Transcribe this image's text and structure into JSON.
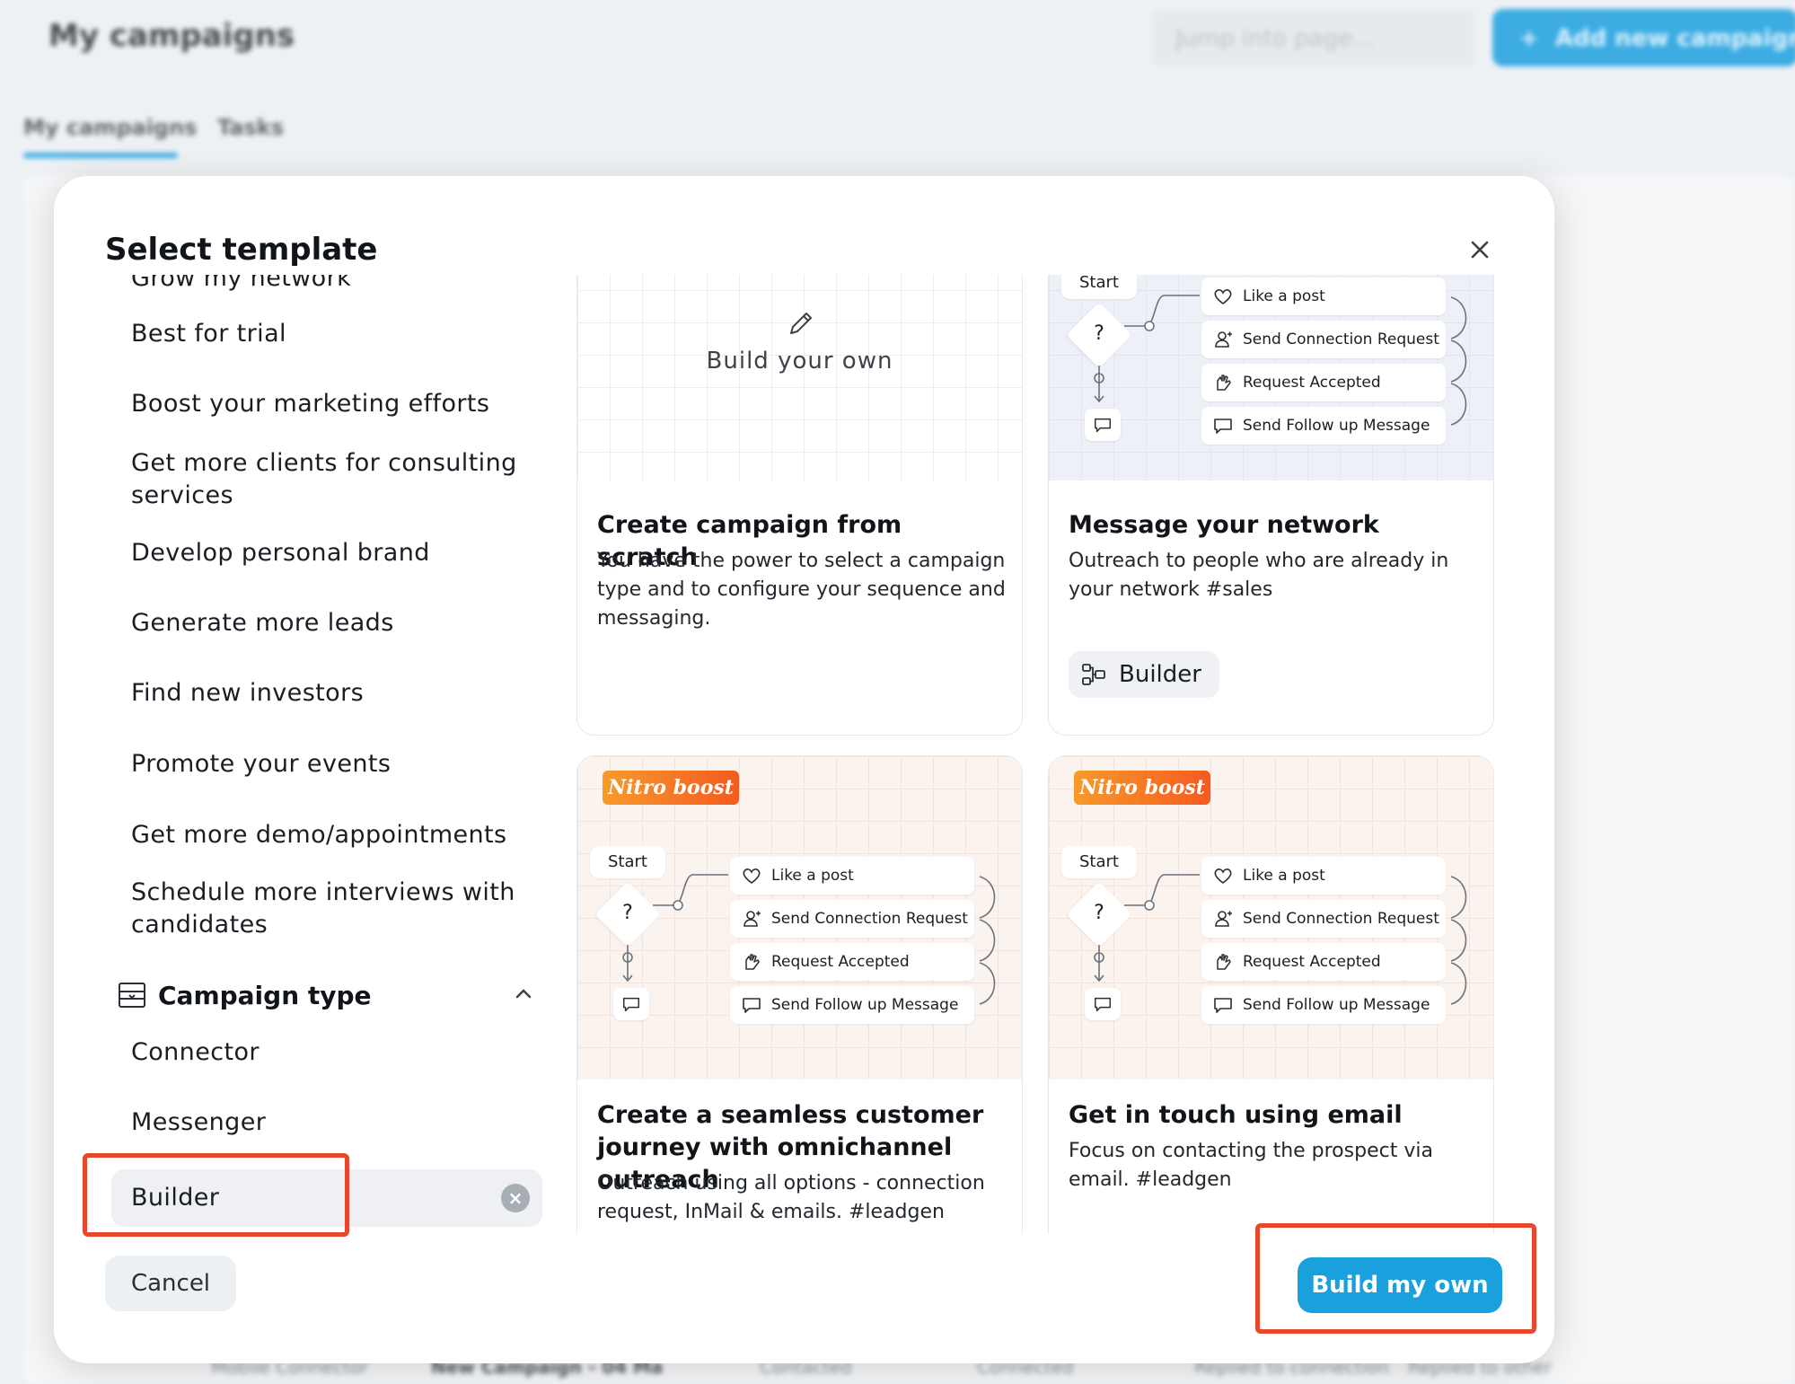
{
  "background": {
    "page_title": "My campaigns",
    "search_placeholder": "Jump into page...",
    "add_button": "Add new campaign",
    "add_icon": "plus-icon",
    "tabs": [
      {
        "label": "My campaigns"
      },
      {
        "label": "Tasks"
      }
    ],
    "row_texts": [
      "Mobile Connector",
      "New Campaign - 04 Ma",
      "Contacted",
      "Connected",
      "Replied to connection",
      "Replied to other"
    ]
  },
  "modal": {
    "title": "Select template",
    "close_icon": "close-icon",
    "goals": [
      {
        "label": "Grow my network"
      },
      {
        "label": "Best for trial"
      },
      {
        "label": "Boost your marketing efforts"
      },
      {
        "label": "Get more clients for consulting services"
      },
      {
        "label": "Develop personal brand"
      },
      {
        "label": "Generate more leads"
      },
      {
        "label": "Find new investors"
      },
      {
        "label": "Promote your events"
      },
      {
        "label": "Get more demo/appointments"
      },
      {
        "label": "Schedule more interviews with candidates"
      }
    ],
    "campaign_type": {
      "label": "Campaign type",
      "icon": "campaign-type-icon",
      "chevron": "chevron-up-icon",
      "items": [
        {
          "label": "Connector"
        },
        {
          "label": "Messenger"
        },
        {
          "label": "Builder",
          "selected": true
        }
      ]
    },
    "cards": [
      {
        "preview": "build-your-own",
        "preview_label": "Build your own",
        "title": "Create campaign from scratch",
        "description": "You have the power to select a campaign type and to configure your sequence and messaging."
      },
      {
        "preview": "flow",
        "title": "Message your network",
        "description": "Outreach to people who are already in your network #sales",
        "tag": "Builder"
      },
      {
        "preview": "flow",
        "badge": "Nitro boost",
        "title": "Create a seamless customer journey with omnichannel outreach",
        "description": "Outreach using all options - connection request, InMail & emails. #leadgen"
      },
      {
        "preview": "flow",
        "badge": "Nitro boost",
        "title": "Get in touch using email",
        "description": "Focus on contacting the prospect via email. #leadgen"
      }
    ],
    "flow": {
      "start": "Start",
      "question": "?",
      "steps": [
        {
          "label": "Like a post",
          "icon": "heart-icon"
        },
        {
          "label": "Send Connection Request",
          "icon": "user-add-icon"
        },
        {
          "label": "Request Accepted",
          "icon": "handshake-icon"
        },
        {
          "label": "Send Follow up Message",
          "icon": "message-icon"
        }
      ]
    },
    "cancel": "Cancel",
    "build": "Build my own"
  },
  "colors": {
    "accent": "#1aa0dd",
    "highlight": "#e8472c",
    "nitro_start": "#f79a2b",
    "nitro_end": "#f55a1f"
  }
}
